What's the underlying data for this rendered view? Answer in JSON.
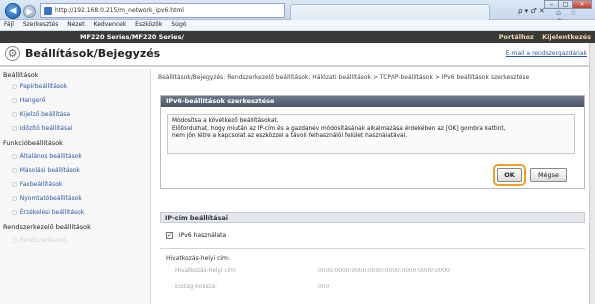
{
  "browser": {
    "url": "http://192.168.0.215/m_network_ipv6.html",
    "nav_back": "◀",
    "nav_forward": "▶",
    "address_tools": "ρ ▾ ♂ ✕",
    "home_icons": "⌂ ☆ ⚙",
    "window_buttons": {
      "min": "‒",
      "max": "□",
      "close": "✕"
    },
    "menu": [
      "Fájl",
      "Szerkesztés",
      "Nézet",
      "Kedvencek",
      "Eszközök",
      "Súgó"
    ]
  },
  "printer_bar": {
    "model": "MF220 Series/MF220 Series/",
    "portal": "Portálhoz",
    "logout": "Kijelentkezés"
  },
  "header": {
    "title": "Beállítások/Bejegyzés",
    "mail_link": "E-mail a rendszergazdának"
  },
  "sidebar": {
    "heading1": "Beállítások",
    "items1": [
      "Papírbeállítások",
      "Hangerő",
      "Kijelző beállítása",
      "Időzítő beállításai"
    ],
    "heading2": "Funkcióbeállítások",
    "items2": [
      "Általános beállítások",
      "Másolási beállítások",
      "Faxbeállítások",
      "Nyomtatóbeállítások",
      "Érzékelési beállítások"
    ],
    "heading3": "Rendszerkezelő beállítások",
    "items3": [
      "Rendszerkezelő"
    ]
  },
  "breadcrumb": "Beállítások/Bejegyzés: Rendszerkezelő beállítások: Hálózati beállítások > TCP/IP-beállítások > IPv6 beállítások szerkesztése",
  "dialog": {
    "title": "IPv6-beállítások szerkesztése",
    "message_line1": "Módosítsa a következő beállításokat.",
    "message_line2": "Előfordulhat, hogy miután az IP-cím és a gazdanév módosításának alkalmazása érdekében az [OK] gombra kattint,",
    "message_line3": "nem jön létre a kapcsolat az eszközzel a távoli felhasználói felület használatával.",
    "ok": "OK",
    "cancel": "Mégse"
  },
  "ip_section": {
    "heading": "IP-cím beállításai",
    "checkbox_label": "IPv6 használata",
    "checkbox_mark": "✓",
    "link_local_label": "Hivatkozás-helyi cím:",
    "link_local_key": "Hivatkozás-helyi cím:",
    "link_local_value": "0000:0000:0000:0000:0000:0000:0000:0000",
    "prefix_key": "Előtag hossza:",
    "prefix_value": "000"
  }
}
